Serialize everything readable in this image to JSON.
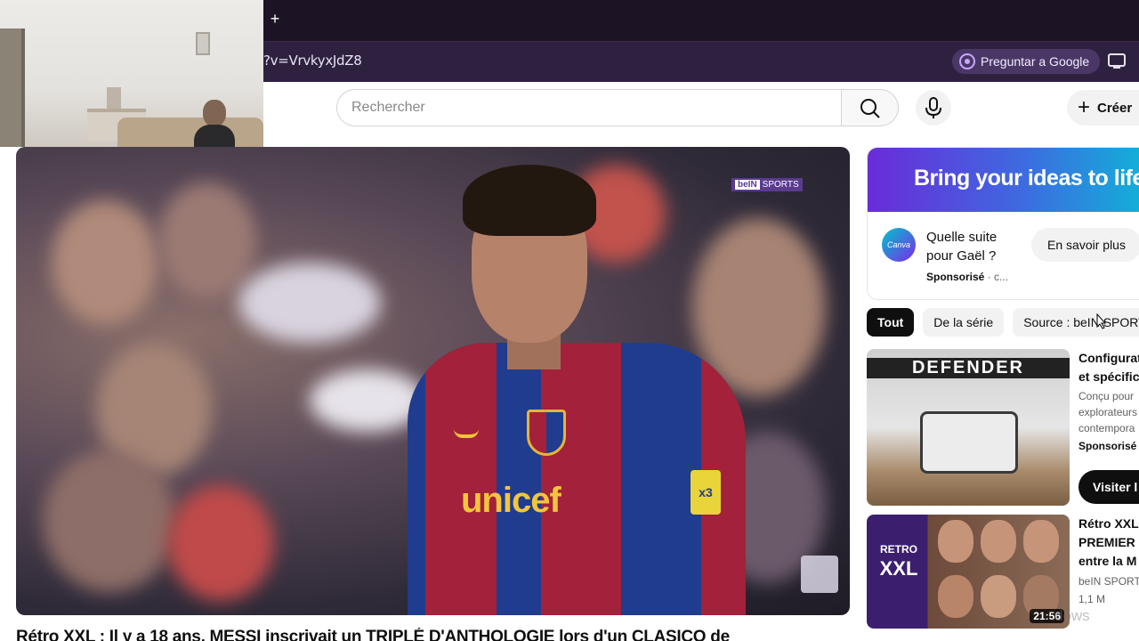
{
  "browser": {
    "new_tab": "+",
    "url": "?v=VrvkyxJdZ8",
    "ask_google": "Preguntar a Google"
  },
  "header": {
    "search_placeholder": "Rechercher",
    "create_label": "Créer"
  },
  "player": {
    "channel_watermark_a": "beIN",
    "channel_watermark_b": "SPORTS",
    "shirt_sponsor": "unicef",
    "sleeve_patch": "x3"
  },
  "video": {
    "title": "Rétro XXL : Il y a 18 ans, MESSI inscrivait un TRIPLÉ D'ANTHOLOGIE lors d'un CLASICO de"
  },
  "sidebar": {
    "ad": {
      "banner": "Bring your ideas to life",
      "logo": "Canva",
      "text": "Quelle suite pour Gaël ?",
      "sponsored": "Sponsorisé",
      "sponsored_suffix": " · c...",
      "cta": "En savoir plus"
    },
    "chips": [
      "Tout",
      "De la série",
      "Source : beIN SPORTS"
    ],
    "recs": [
      {
        "thumb_word": "DEFENDER",
        "title_lines": [
          "Configurat",
          "et spécific"
        ],
        "meta_lines": [
          "Conçu pour",
          "explorateurs",
          "contempora"
        ],
        "sponsored": "Sponsorisé",
        "visit": "Visiter l"
      },
      {
        "thumb_top": "RETRO",
        "thumb_bottom": "XXL",
        "title_lines": [
          "Rétro XXL",
          "PREMIER C",
          "entre la M"
        ],
        "channel": "beIN SPORT",
        "views": "1,1 M",
        "duration": "21:56"
      }
    ]
  },
  "os_watermark": "dows",
  "colors": {
    "browser_bg": "#1c1324",
    "address_bg": "#2e2140",
    "chip_active": "#0f0f0f"
  }
}
